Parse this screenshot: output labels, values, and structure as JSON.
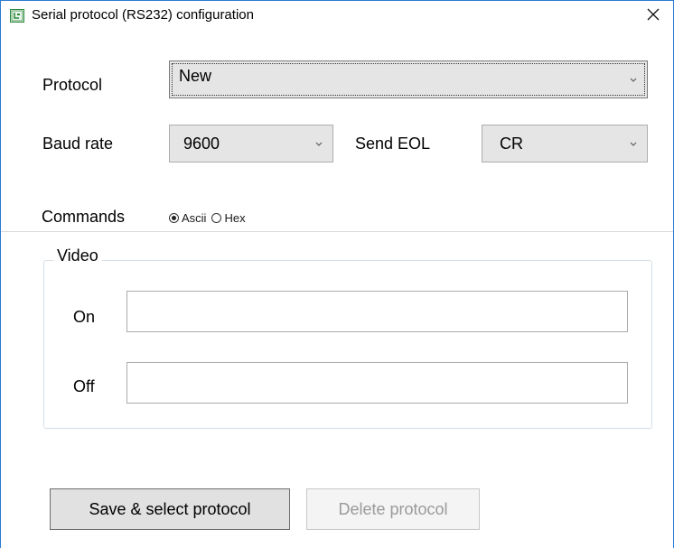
{
  "window": {
    "title": "Serial protocol (RS232) configuration",
    "accent_color": "#2b7cd3"
  },
  "protocol": {
    "label": "Protocol",
    "selected": "New"
  },
  "baud_rate": {
    "label": "Baud rate",
    "selected": "9600"
  },
  "send_eol": {
    "label": "Send EOL",
    "selected": "CR"
  },
  "commands": {
    "label": "Commands",
    "options": [
      {
        "label": "Ascii",
        "checked": true
      },
      {
        "label": "Hex",
        "checked": false
      }
    ]
  },
  "video": {
    "legend": "Video",
    "on_label": "On",
    "on_value": "",
    "off_label": "Off",
    "off_value": ""
  },
  "buttons": {
    "save_label": "Save & select protocol",
    "delete_label": "Delete protocol"
  }
}
